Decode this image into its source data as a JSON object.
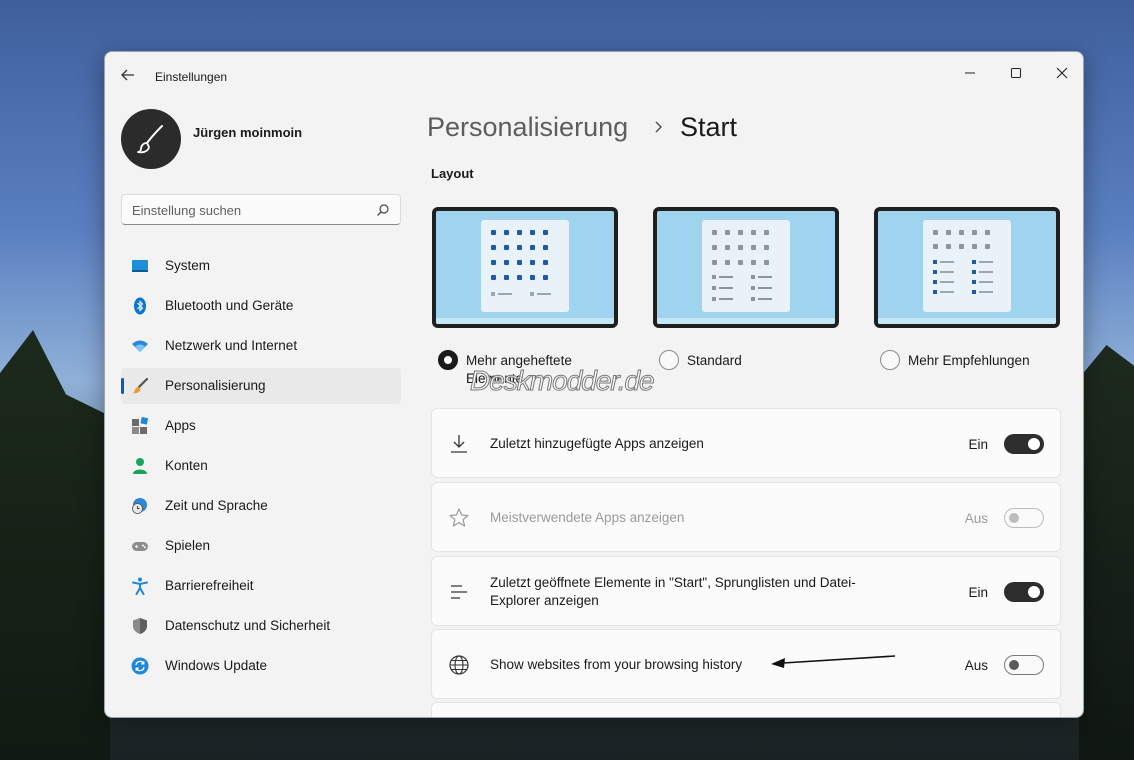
{
  "window": {
    "app_title": "Einstellungen"
  },
  "user": {
    "name": "Jürgen moinmoin"
  },
  "search": {
    "placeholder": "Einstellung suchen"
  },
  "sidebar": {
    "items": [
      {
        "label": "System",
        "icon": "monitor-icon"
      },
      {
        "label": "Bluetooth und Geräte",
        "icon": "bluetooth-icon"
      },
      {
        "label": "Netzwerk und Internet",
        "icon": "wifi-icon"
      },
      {
        "label": "Personalisierung",
        "icon": "paintbrush-icon",
        "active": true
      },
      {
        "label": "Apps",
        "icon": "apps-icon"
      },
      {
        "label": "Konten",
        "icon": "person-icon"
      },
      {
        "label": "Zeit und Sprache",
        "icon": "globe-clock-icon"
      },
      {
        "label": "Spielen",
        "icon": "gamepad-icon"
      },
      {
        "label": "Barrierefreiheit",
        "icon": "accessibility-icon"
      },
      {
        "label": "Datenschutz und Sicherheit",
        "icon": "shield-icon"
      },
      {
        "label": "Windows Update",
        "icon": "update-icon"
      }
    ]
  },
  "breadcrumb": {
    "parent": "Personalisierung",
    "current": "Start"
  },
  "layout": {
    "title": "Layout",
    "options": [
      {
        "label": "Mehr angeheftete Elemente",
        "selected": true
      },
      {
        "label": "Standard",
        "selected": false
      },
      {
        "label": "Mehr Empfehlungen",
        "selected": false
      }
    ]
  },
  "watermark": "Deskmodder.de",
  "settings": [
    {
      "label": "Zuletzt hinzugefügte Apps anzeigen",
      "state": "Ein",
      "on": true,
      "disabled": false,
      "icon": "download-icon"
    },
    {
      "label": "Meistverwendete Apps anzeigen",
      "state": "Aus",
      "on": false,
      "disabled": true,
      "icon": "star-icon"
    },
    {
      "label": "Zuletzt geöffnete Elemente in \"Start\", Sprunglisten und Datei-Explorer anzeigen",
      "state": "Ein",
      "on": true,
      "disabled": false,
      "icon": "list-icon"
    },
    {
      "label": "Show websites from your browsing history",
      "state": "Aus",
      "on": false,
      "disabled": false,
      "icon": "globe-icon"
    }
  ],
  "colors": {
    "accent": "#005fb8",
    "toggle_on": "#2d2d2d"
  }
}
